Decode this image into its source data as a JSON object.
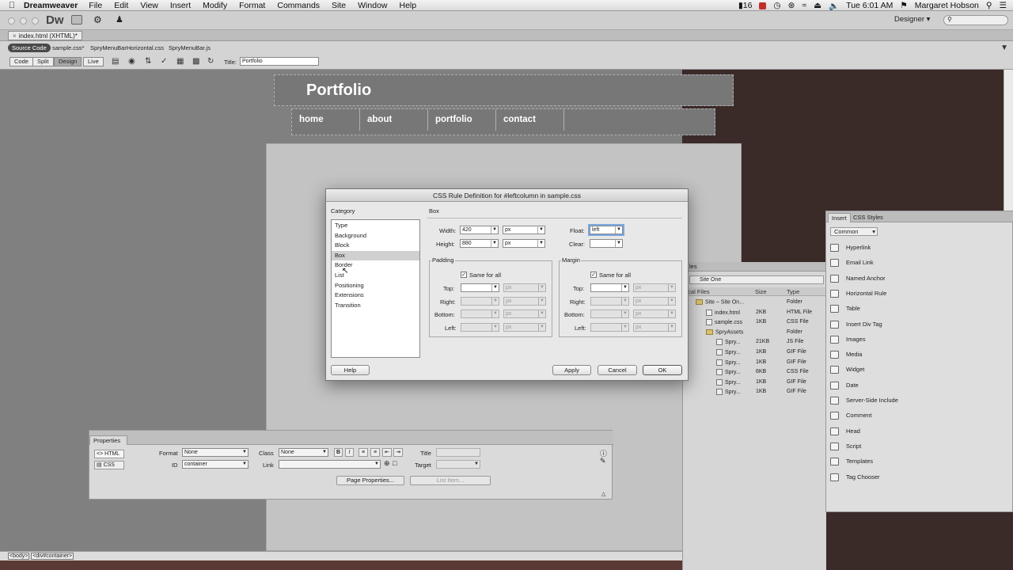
{
  "menubar": {
    "app": "Dreamweaver",
    "items": [
      "File",
      "Edit",
      "View",
      "Insert",
      "Modify",
      "Format",
      "Commands",
      "Site",
      "Window",
      "Help"
    ],
    "battery": "16",
    "clock": "Tue 6:01 AM",
    "user": "Margaret Hobson"
  },
  "appbar": {
    "logo": "Dw",
    "workspace": "Designer"
  },
  "doc_tab": "index.html (XHTML)*",
  "related_files": {
    "source": "Source Code",
    "files": [
      "sample.css*",
      "SpryMenuBarHorizontal.css",
      "SpryMenuBar.js"
    ]
  },
  "doc_toolbar": {
    "views": [
      "Code",
      "Split",
      "Design",
      "Live"
    ],
    "title_label": "Title:",
    "title_value": "Portfolio"
  },
  "page": {
    "header_title": "Portfolio",
    "nav": [
      "home",
      "about",
      "portfolio",
      "contact"
    ]
  },
  "status_bar": {
    "tags": [
      "<body>",
      "<div#container>"
    ]
  },
  "dialog": {
    "title": "CSS Rule Definition for #leftcolumn in sample.css",
    "category_label": "Category",
    "categories": [
      "Type",
      "Background",
      "Block",
      "Box",
      "Border",
      "List",
      "Positioning",
      "Extensions",
      "Transition"
    ],
    "selected_category": "Box",
    "section": "Box",
    "width_label": "Width:",
    "width_value": "420",
    "width_unit": "px",
    "height_label": "Height:",
    "height_value": "880",
    "height_unit": "px",
    "float_label": "Float:",
    "float_value": "left",
    "clear_label": "Clear:",
    "padding_label": "Padding",
    "margin_label": "Margin",
    "same_for_all": "Same for all",
    "sides": [
      "Top:",
      "Right:",
      "Bottom:",
      "Left:"
    ],
    "unit_px": "px",
    "buttons": {
      "help": "Help",
      "apply": "Apply",
      "cancel": "Cancel",
      "ok": "OK"
    }
  },
  "properties": {
    "tab": "Properties",
    "html_btn": "HTML",
    "css_btn": "CSS",
    "format_label": "Format",
    "format_value": "None",
    "class_label": "Class",
    "class_value": "None",
    "title_label": "Title",
    "id_label": "ID",
    "id_value": "container",
    "link_label": "Link",
    "target_label": "Target",
    "page_properties": "Page Properties...",
    "list_item": "List Item..."
  },
  "files_panel": {
    "tab_partial": "les",
    "site": "Site One",
    "col_files": "ocal Files",
    "col_size": "Size",
    "col_type": "Type",
    "rows": [
      {
        "name": "Site – Site On...",
        "size": "",
        "type": "Folder",
        "indent": 0,
        "folder": true
      },
      {
        "name": "index.html",
        "size": "2KB",
        "type": "HTML File",
        "indent": 1,
        "folder": false
      },
      {
        "name": "sample.css",
        "size": "1KB",
        "type": "CSS File",
        "indent": 1,
        "folder": false
      },
      {
        "name": "SpryAssets",
        "size": "",
        "type": "Folder",
        "indent": 1,
        "folder": true
      },
      {
        "name": "Spry...",
        "size": "21KB",
        "type": "JS File",
        "indent": 2,
        "folder": false
      },
      {
        "name": "Spry...",
        "size": "1KB",
        "type": "GIF File",
        "indent": 2,
        "folder": false
      },
      {
        "name": "Spry...",
        "size": "1KB",
        "type": "GIF File",
        "indent": 2,
        "folder": false
      },
      {
        "name": "Spry...",
        "size": "6KB",
        "type": "CSS File",
        "indent": 2,
        "folder": false
      },
      {
        "name": "Spry...",
        "size": "1KB",
        "type": "GIF File",
        "indent": 2,
        "folder": false
      },
      {
        "name": "Spry...",
        "size": "1KB",
        "type": "GIF File",
        "indent": 2,
        "folder": false
      }
    ]
  },
  "insert_panel": {
    "tabs": [
      "Insert",
      "CSS Styles"
    ],
    "category": "Common",
    "items": [
      "Hyperlink",
      "Email Link",
      "Named Anchor",
      "Horizontal Rule",
      "Table",
      "Insert Div Tag",
      "Images",
      "Media",
      "Widget",
      "Date",
      "Server-Side Include",
      "Comment",
      "Head",
      "Script",
      "Templates",
      "Tag Chooser"
    ]
  }
}
